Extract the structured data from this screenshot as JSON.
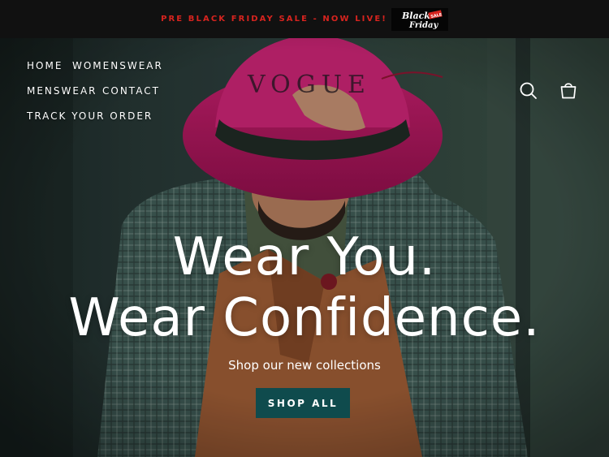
{
  "announcement": {
    "text": "PRE BLACK FRIDAY SALE - NOW LIVE!",
    "badge_line1": "Black",
    "badge_line2": "Friday",
    "badge_tag": "SALE"
  },
  "nav": {
    "home": "HOME",
    "womenswear": "WOMENSWEAR",
    "menswear": "MENSWEAR",
    "contact": "CONTACT",
    "track_order": "TRACK YOUR ORDER"
  },
  "logo": "VOGUE",
  "icons": {
    "search": "search-icon",
    "cart": "cart-icon"
  },
  "hero": {
    "headline_line1": "Wear You.",
    "headline_line2": "Wear Confidence.",
    "subheading": "Shop our new collections",
    "cta_label": "SHOP ALL"
  },
  "colors": {
    "announcement_bg": "#111111",
    "announcement_text": "#d7241f",
    "cta_bg": "#0f4b4d",
    "hat": "#b0155c"
  }
}
